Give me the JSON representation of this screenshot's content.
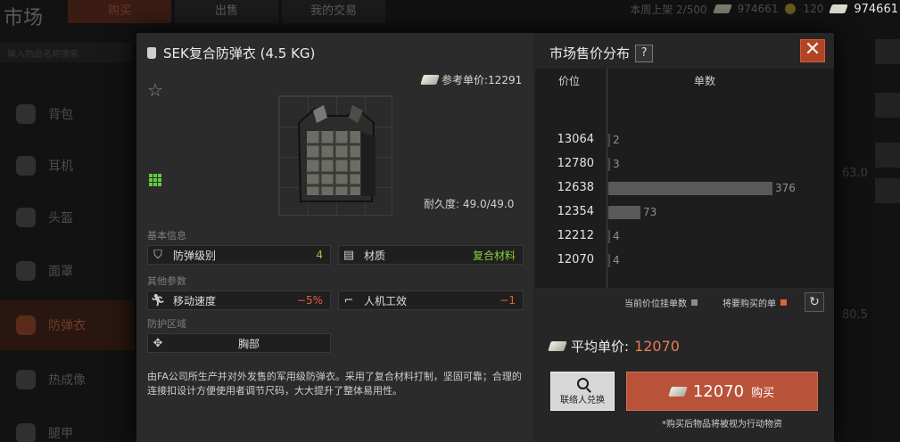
{
  "background": {
    "title": "市场",
    "tabs": [
      {
        "label": "购买",
        "active": true
      },
      {
        "label": "出售",
        "active": false
      },
      {
        "label": "我的交易",
        "active": false
      }
    ],
    "topbar": {
      "weekly_listing": "本周上架 2/500",
      "money_1": "974661",
      "coins": "120",
      "money_2": "974661"
    },
    "search_placeholder": "输入物品名称搜索",
    "categories": [
      {
        "label": "背包",
        "active": false
      },
      {
        "label": "耳机",
        "active": false
      },
      {
        "label": "头盔",
        "active": false
      },
      {
        "label": "面罩",
        "active": false
      },
      {
        "label": "防弹衣",
        "active": true
      },
      {
        "label": "热成像",
        "active": false
      },
      {
        "label": "腿甲",
        "active": false
      }
    ],
    "right_values": [
      "63.0",
      "80.5"
    ]
  },
  "item": {
    "name": "SEK复合防弹衣 (4.5 KG)",
    "reference_price_label": "参考单价:12291",
    "durability": "耐久度: 49.0/49.0",
    "basic_info_label": "基本信息",
    "stats_basic": [
      {
        "icon": "shield-icon",
        "label": "防弹级别",
        "value": "4",
        "tone": "green"
      },
      {
        "icon": "material-icon",
        "label": "材质",
        "value": "复合材料",
        "tone": "green"
      }
    ],
    "other_params_label": "其他参数",
    "stats_other": [
      {
        "icon": "running-icon",
        "label": "移动速度",
        "value": "−5%",
        "tone": "red"
      },
      {
        "icon": "pistol-icon",
        "label": "人机工效",
        "value": "−1",
        "tone": "red"
      }
    ],
    "protection_label": "防护区域",
    "protection_zone": "胸部",
    "description": "由FA公司所生产并对外发售的军用级防弹衣。采用了复合材料打制，坚固可靠；合理的连接扣设计方便使用者调节尺码，大大提升了整体易用性。"
  },
  "market": {
    "title": "市场售价分布",
    "help_label": "?",
    "close_label": "✕",
    "col_price": "价位",
    "col_count": "单数",
    "legend_current": "当前价位挂单数",
    "legend_pending": "将要购买的单",
    "avg_label": "平均单价:",
    "avg_value": "12070",
    "contact_label": "联络人兑换",
    "buy_price": "12070",
    "buy_label": "购买",
    "footnote": "*购买后物品将被视为行动物资",
    "colors": {
      "current": "#595959",
      "pending": "#e0643c",
      "accent": "#b8533a"
    }
  },
  "chart_data": {
    "type": "bar",
    "orientation": "horizontal",
    "categories": [
      "13064",
      "12780",
      "12638",
      "12354",
      "12212",
      "12070"
    ],
    "series": [
      {
        "name": "当前价位挂单数",
        "values": [
          2,
          3,
          376,
          73,
          4,
          4
        ]
      }
    ],
    "xlabel": "单数",
    "ylabel": "价位",
    "xlim": [
      0,
      376
    ]
  }
}
